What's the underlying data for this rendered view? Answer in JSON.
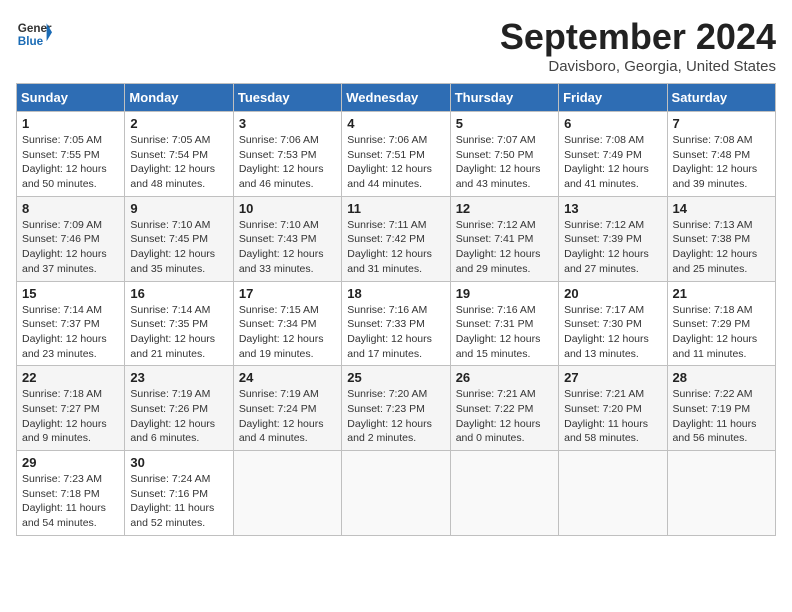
{
  "header": {
    "logo_line1": "General",
    "logo_line2": "Blue",
    "month_title": "September 2024",
    "location": "Davisboro, Georgia, United States"
  },
  "weekdays": [
    "Sunday",
    "Monday",
    "Tuesday",
    "Wednesday",
    "Thursday",
    "Friday",
    "Saturday"
  ],
  "weeks": [
    [
      {
        "day": "1",
        "sunrise": "7:05 AM",
        "sunset": "7:55 PM",
        "daylight": "12 hours and 50 minutes."
      },
      {
        "day": "2",
        "sunrise": "7:05 AM",
        "sunset": "7:54 PM",
        "daylight": "12 hours and 48 minutes."
      },
      {
        "day": "3",
        "sunrise": "7:06 AM",
        "sunset": "7:53 PM",
        "daylight": "12 hours and 46 minutes."
      },
      {
        "day": "4",
        "sunrise": "7:06 AM",
        "sunset": "7:51 PM",
        "daylight": "12 hours and 44 minutes."
      },
      {
        "day": "5",
        "sunrise": "7:07 AM",
        "sunset": "7:50 PM",
        "daylight": "12 hours and 43 minutes."
      },
      {
        "day": "6",
        "sunrise": "7:08 AM",
        "sunset": "7:49 PM",
        "daylight": "12 hours and 41 minutes."
      },
      {
        "day": "7",
        "sunrise": "7:08 AM",
        "sunset": "7:48 PM",
        "daylight": "12 hours and 39 minutes."
      }
    ],
    [
      {
        "day": "8",
        "sunrise": "7:09 AM",
        "sunset": "7:46 PM",
        "daylight": "12 hours and 37 minutes."
      },
      {
        "day": "9",
        "sunrise": "7:10 AM",
        "sunset": "7:45 PM",
        "daylight": "12 hours and 35 minutes."
      },
      {
        "day": "10",
        "sunrise": "7:10 AM",
        "sunset": "7:43 PM",
        "daylight": "12 hours and 33 minutes."
      },
      {
        "day": "11",
        "sunrise": "7:11 AM",
        "sunset": "7:42 PM",
        "daylight": "12 hours and 31 minutes."
      },
      {
        "day": "12",
        "sunrise": "7:12 AM",
        "sunset": "7:41 PM",
        "daylight": "12 hours and 29 minutes."
      },
      {
        "day": "13",
        "sunrise": "7:12 AM",
        "sunset": "7:39 PM",
        "daylight": "12 hours and 27 minutes."
      },
      {
        "day": "14",
        "sunrise": "7:13 AM",
        "sunset": "7:38 PM",
        "daylight": "12 hours and 25 minutes."
      }
    ],
    [
      {
        "day": "15",
        "sunrise": "7:14 AM",
        "sunset": "7:37 PM",
        "daylight": "12 hours and 23 minutes."
      },
      {
        "day": "16",
        "sunrise": "7:14 AM",
        "sunset": "7:35 PM",
        "daylight": "12 hours and 21 minutes."
      },
      {
        "day": "17",
        "sunrise": "7:15 AM",
        "sunset": "7:34 PM",
        "daylight": "12 hours and 19 minutes."
      },
      {
        "day": "18",
        "sunrise": "7:16 AM",
        "sunset": "7:33 PM",
        "daylight": "12 hours and 17 minutes."
      },
      {
        "day": "19",
        "sunrise": "7:16 AM",
        "sunset": "7:31 PM",
        "daylight": "12 hours and 15 minutes."
      },
      {
        "day": "20",
        "sunrise": "7:17 AM",
        "sunset": "7:30 PM",
        "daylight": "12 hours and 13 minutes."
      },
      {
        "day": "21",
        "sunrise": "7:18 AM",
        "sunset": "7:29 PM",
        "daylight": "12 hours and 11 minutes."
      }
    ],
    [
      {
        "day": "22",
        "sunrise": "7:18 AM",
        "sunset": "7:27 PM",
        "daylight": "12 hours and 9 minutes."
      },
      {
        "day": "23",
        "sunrise": "7:19 AM",
        "sunset": "7:26 PM",
        "daylight": "12 hours and 6 minutes."
      },
      {
        "day": "24",
        "sunrise": "7:19 AM",
        "sunset": "7:24 PM",
        "daylight": "12 hours and 4 minutes."
      },
      {
        "day": "25",
        "sunrise": "7:20 AM",
        "sunset": "7:23 PM",
        "daylight": "12 hours and 2 minutes."
      },
      {
        "day": "26",
        "sunrise": "7:21 AM",
        "sunset": "7:22 PM",
        "daylight": "12 hours and 0 minutes."
      },
      {
        "day": "27",
        "sunrise": "7:21 AM",
        "sunset": "7:20 PM",
        "daylight": "11 hours and 58 minutes."
      },
      {
        "day": "28",
        "sunrise": "7:22 AM",
        "sunset": "7:19 PM",
        "daylight": "11 hours and 56 minutes."
      }
    ],
    [
      {
        "day": "29",
        "sunrise": "7:23 AM",
        "sunset": "7:18 PM",
        "daylight": "11 hours and 54 minutes."
      },
      {
        "day": "30",
        "sunrise": "7:24 AM",
        "sunset": "7:16 PM",
        "daylight": "11 hours and 52 minutes."
      },
      null,
      null,
      null,
      null,
      null
    ]
  ]
}
